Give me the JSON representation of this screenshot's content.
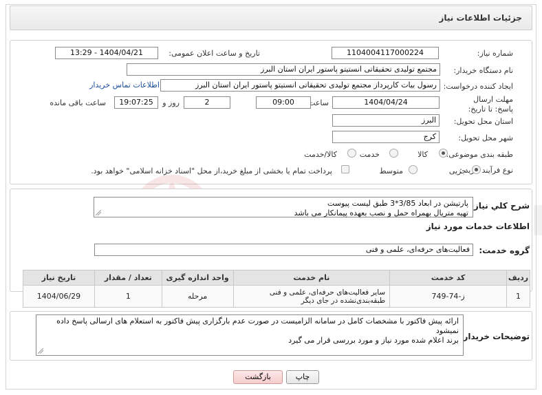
{
  "header": {
    "title": "جزئیات اطلاعات نیاز"
  },
  "info": {
    "need_number_label": "شماره نیاز:",
    "need_number": "1104004117000224",
    "announce_label": "تاریخ و ساعت اعلان عمومی:",
    "announce_value": "1404/04/21 - 13:29",
    "buyer_org_label": "نام دستگاه خریدار:",
    "buyer_org": "مجتمع تولیدی تحقیقاتی انستیتو پاستور ایران استان البرز",
    "creator_label": "ایجاد کننده درخواست:",
    "creator": "رسول بیات کارپرداز مجتمع تولیدی تحقیقاتی انستیتو پاستور ایران استان البرز",
    "contact_link": "اطلاعات تماس خریدار",
    "deadline_label": "مهلت ارسال پاسخ: تا تاریخ:",
    "deadline_date": "1404/04/24",
    "time_label": "ساعت",
    "deadline_time": "09:00",
    "days": "2",
    "days_label": "روز و",
    "remaining": "19:07:25",
    "remaining_label": "ساعت باقی مانده",
    "province_label": "استان محل تحویل:",
    "province": "البرز",
    "city_label": "شهر محل تحویل:",
    "city": "کرج",
    "category_label": "طبقه بندی موضوعی:",
    "category_options": [
      "کالا",
      "خدمت",
      "کالا/خدمت"
    ],
    "process_label": "نوع فرآیند خرید :",
    "process_options": [
      "جزیی",
      "متوسط"
    ],
    "payment_note": "پرداخت تمام یا بخشی از مبلغ خرید،از محل \"اسناد خزانه اسلامی\" خواهد بود."
  },
  "summary": {
    "label": "شرح کلي نياز:",
    "line1": "پارتیشن در ابعاد 3/85*3 طبق لیست پیوست",
    "line2": "تهیه متریال بهمراه حمل و نصب بعهده پیمانکار می باشد"
  },
  "services": {
    "section_title": "اطلاعات خدمات مورد نياز",
    "group_label": "گروه خدمت:",
    "group_value": "فعالیت‌های حرفه‌ای، علمی و فنی",
    "columns": [
      "ردیف",
      "کد خدمت",
      "نام خدمت",
      "واحد اندازه گیری",
      "تعداد / مقدار",
      "تاریخ نیاز"
    ],
    "rows": [
      {
        "index": "1",
        "code": "ز-74-749",
        "name": "سایر فعالیت‌های حرفه‌ای، علمی و فنی طبقه‌بندی‌نشده در جای دیگر",
        "unit": "مرحله",
        "qty": "1",
        "date": "1404/06/29"
      }
    ]
  },
  "buyer_notes": {
    "label": "توضیحات خریدار:",
    "line1": "ارائه پیش فاکتور با مشخصات کامل در سامانه الزامیست در صورت عدم بارگزاری پیش فاکتور به استعلام های ارسالی پاسخ داده نمیشود",
    "line2": "برند اعلام شده مورد نیاز و مورد  بررسی قرار می گیرد"
  },
  "buttons": {
    "print": "چاپ",
    "back": "بازگشت"
  }
}
